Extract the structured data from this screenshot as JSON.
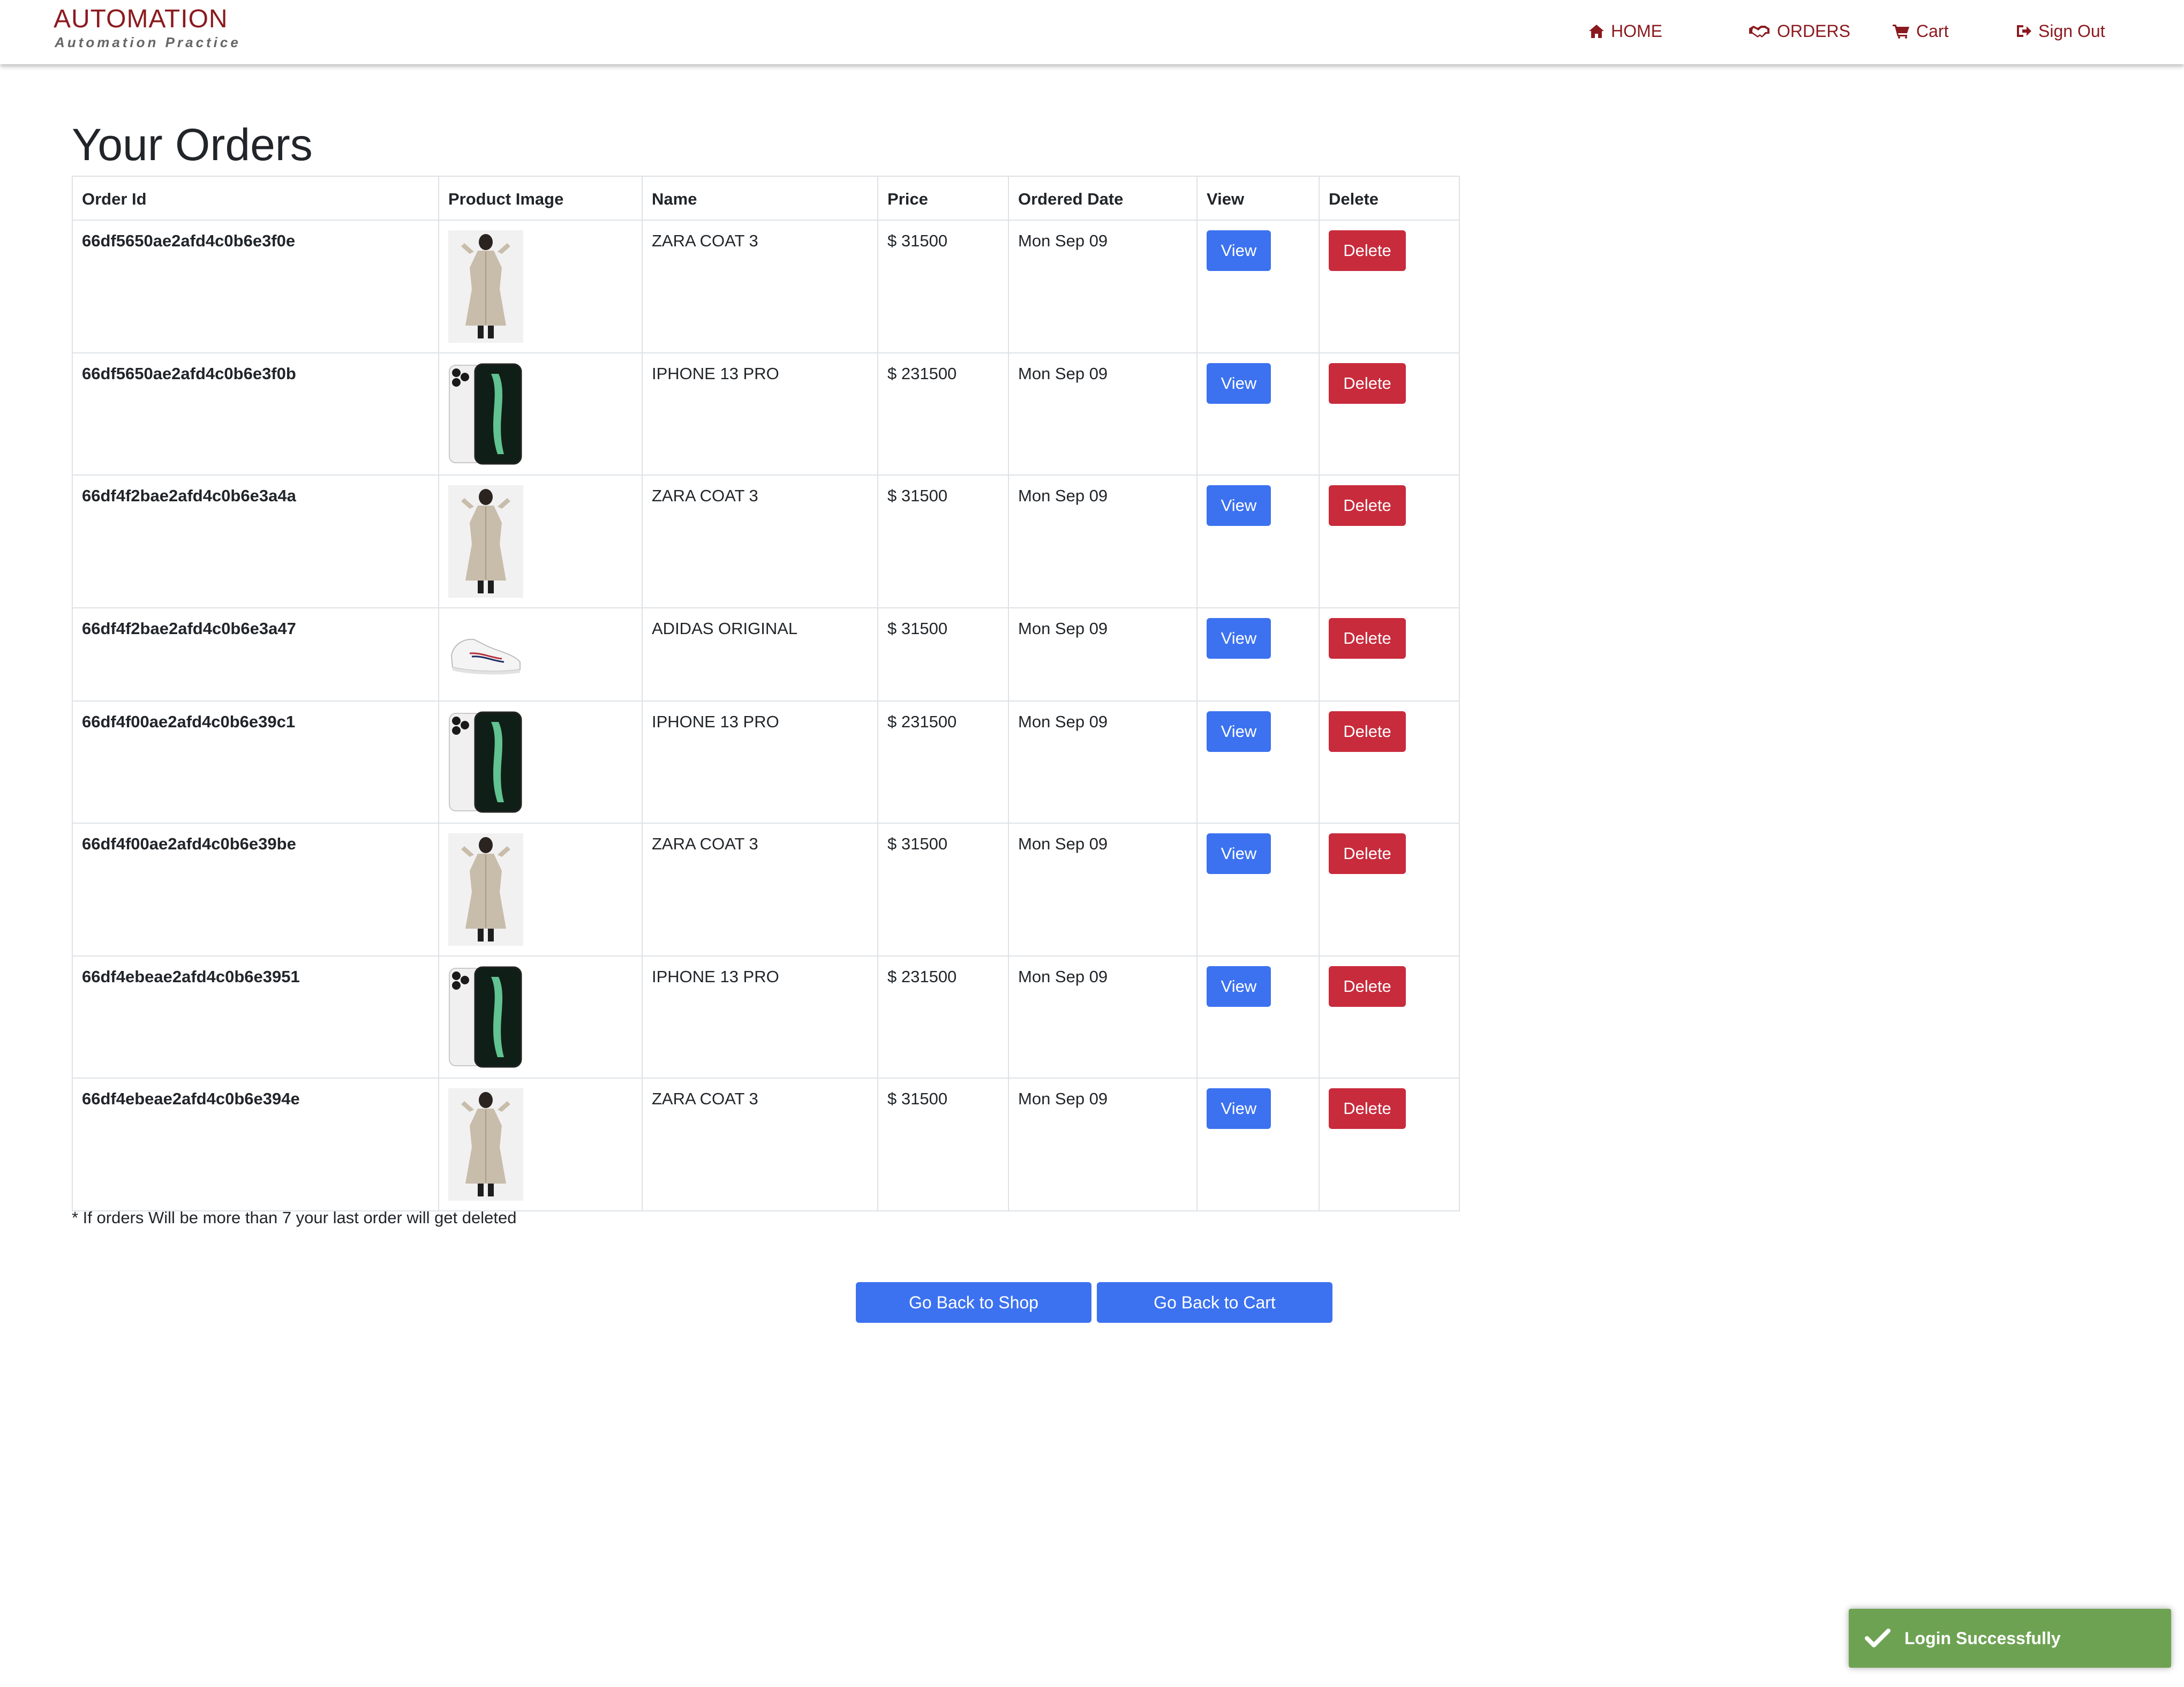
{
  "brand": {
    "title": "AUTOMATION",
    "subtitle": "Automation Practice"
  },
  "nav": {
    "home": "HOME",
    "orders": "ORDERS",
    "cart": "Cart",
    "signout": "Sign Out"
  },
  "colors": {
    "brand_maroon": "#8b1a1f",
    "primary_blue": "#3c72f0",
    "danger_red": "#c82b3c",
    "toast_green": "#6ea253"
  },
  "page": {
    "title": "Your Orders"
  },
  "table": {
    "headers": [
      "Order Id",
      "Product Image",
      "Name",
      "Price",
      "Ordered Date",
      "View",
      "Delete"
    ],
    "rows": [
      {
        "id": "66df5650ae2afd4c0b6e3f0e",
        "image": "coat-image",
        "name": "ZARA COAT 3",
        "price": "$ 31500",
        "date": "Mon Sep 09",
        "view": "View",
        "delete": "Delete"
      },
      {
        "id": "66df5650ae2afd4c0b6e3f0b",
        "image": "phone-image",
        "name": "IPHONE 13 PRO",
        "price": "$ 231500",
        "date": "Mon Sep 09",
        "view": "View",
        "delete": "Delete"
      },
      {
        "id": "66df4f2bae2afd4c0b6e3a4a",
        "image": "coat-image",
        "name": "ZARA COAT 3",
        "price": "$ 31500",
        "date": "Mon Sep 09",
        "view": "View",
        "delete": "Delete"
      },
      {
        "id": "66df4f2bae2afd4c0b6e3a47",
        "image": "shoe-image",
        "name": "ADIDAS ORIGINAL",
        "price": "$ 31500",
        "date": "Mon Sep 09",
        "view": "View",
        "delete": "Delete"
      },
      {
        "id": "66df4f00ae2afd4c0b6e39c1",
        "image": "phone-image",
        "name": "IPHONE 13 PRO",
        "price": "$ 231500",
        "date": "Mon Sep 09",
        "view": "View",
        "delete": "Delete"
      },
      {
        "id": "66df4f00ae2afd4c0b6e39be",
        "image": "coat-image",
        "name": "ZARA COAT 3",
        "price": "$ 31500",
        "date": "Mon Sep 09",
        "view": "View",
        "delete": "Delete"
      },
      {
        "id": "66df4ebeae2afd4c0b6e3951",
        "image": "phone-image",
        "name": "IPHONE 13 PRO",
        "price": "$ 231500",
        "date": "Mon Sep 09",
        "view": "View",
        "delete": "Delete"
      },
      {
        "id": "66df4ebeae2afd4c0b6e394e",
        "image": "coat-image",
        "name": "ZARA COAT 3",
        "price": "$ 31500",
        "date": "Mon Sep 09",
        "view": "View",
        "delete": "Delete"
      }
    ]
  },
  "note": "* If orders Will be more than 7 your last order will get deleted",
  "actions": {
    "back_to_shop": "Go Back to Shop",
    "back_to_cart": "Go Back to Cart"
  },
  "toast": {
    "message": "Login Successfully"
  }
}
